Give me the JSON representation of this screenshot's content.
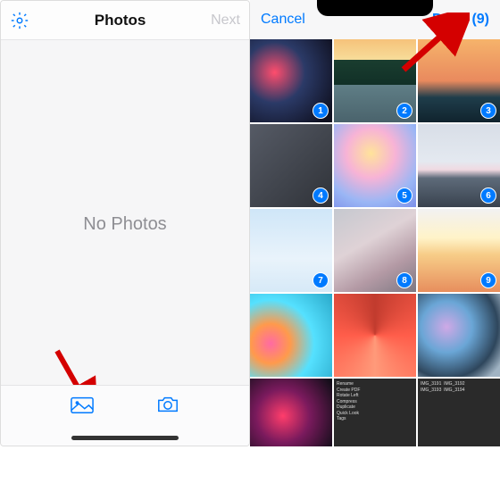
{
  "colors": {
    "accent": "#007aff",
    "muted": "#8e8e93",
    "arrow": "#d40000"
  },
  "left_panel": {
    "title": "Photos",
    "next_label": "Next",
    "empty_text": "No Photos",
    "tabs": {
      "library_icon": "photo-library-icon",
      "camera_icon": "camera-icon"
    }
  },
  "right_panel": {
    "cancel_label": "Cancel",
    "done_label": "Done (9)",
    "selected_count": 9,
    "thumbs": [
      {
        "name": "abstract-red-blue",
        "selected": true,
        "index": 1
      },
      {
        "name": "mountain-lake-sunset",
        "selected": true,
        "index": 2
      },
      {
        "name": "ocean-sunset-dark",
        "selected": true,
        "index": 3
      },
      {
        "name": "grey-texture",
        "selected": true,
        "index": 4
      },
      {
        "name": "soft-pastel-gradient",
        "selected": true,
        "index": 5
      },
      {
        "name": "mountain-sky",
        "selected": true,
        "index": 6
      },
      {
        "name": "blue-clouds",
        "selected": true,
        "index": 7
      },
      {
        "name": "grey-pink-gradient",
        "selected": true,
        "index": 8
      },
      {
        "name": "orange-sunrise",
        "selected": true,
        "index": 9
      },
      {
        "name": "color-bokeh",
        "selected": false,
        "index": null
      },
      {
        "name": "red-fluid-swirl",
        "selected": false,
        "index": null
      },
      {
        "name": "liquid-marble",
        "selected": false,
        "index": null
      },
      {
        "name": "dark-ink",
        "selected": false,
        "index": null
      },
      {
        "name": "finder-context-menu",
        "selected": false,
        "index": null
      },
      {
        "name": "finder-list-dark",
        "selected": false,
        "index": null
      }
    ]
  }
}
